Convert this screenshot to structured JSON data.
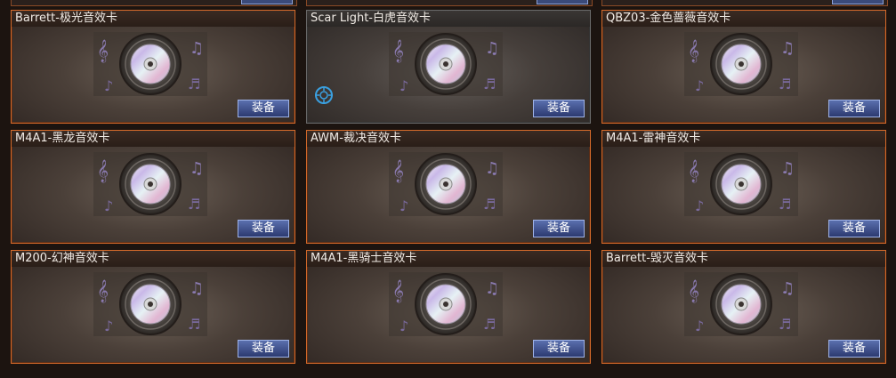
{
  "equip_label": "装备",
  "colors": {
    "card_border": "#d56a2a",
    "selected_border": "#6a6a6a",
    "button_fill": "#2c3a70",
    "button_border": "#9fb3e8",
    "target_icon": "#3aa0e0"
  },
  "cards": [
    {
      "title": "Barrett-极光音效卡",
      "selected": false,
      "icon": "sound-card-disc-icon"
    },
    {
      "title": "Scar Light-白虎音效卡",
      "selected": true,
      "icon": "sound-card-disc-icon"
    },
    {
      "title": "QBZ03-金色蔷薇音效卡",
      "selected": false,
      "icon": "sound-card-disc-icon"
    },
    {
      "title": "M4A1-黑龙音效卡",
      "selected": false,
      "icon": "sound-card-disc-icon"
    },
    {
      "title": "AWM-裁决音效卡",
      "selected": false,
      "icon": "sound-card-disc-icon"
    },
    {
      "title": "M4A1-雷神音效卡",
      "selected": false,
      "icon": "sound-card-disc-icon"
    },
    {
      "title": "M200-幻神音效卡",
      "selected": false,
      "icon": "sound-card-disc-icon"
    },
    {
      "title": "M4A1-黑骑士音效卡",
      "selected": false,
      "icon": "sound-card-disc-icon"
    },
    {
      "title": "Barrett-毁灭音效卡",
      "selected": false,
      "icon": "sound-card-disc-icon"
    }
  ]
}
